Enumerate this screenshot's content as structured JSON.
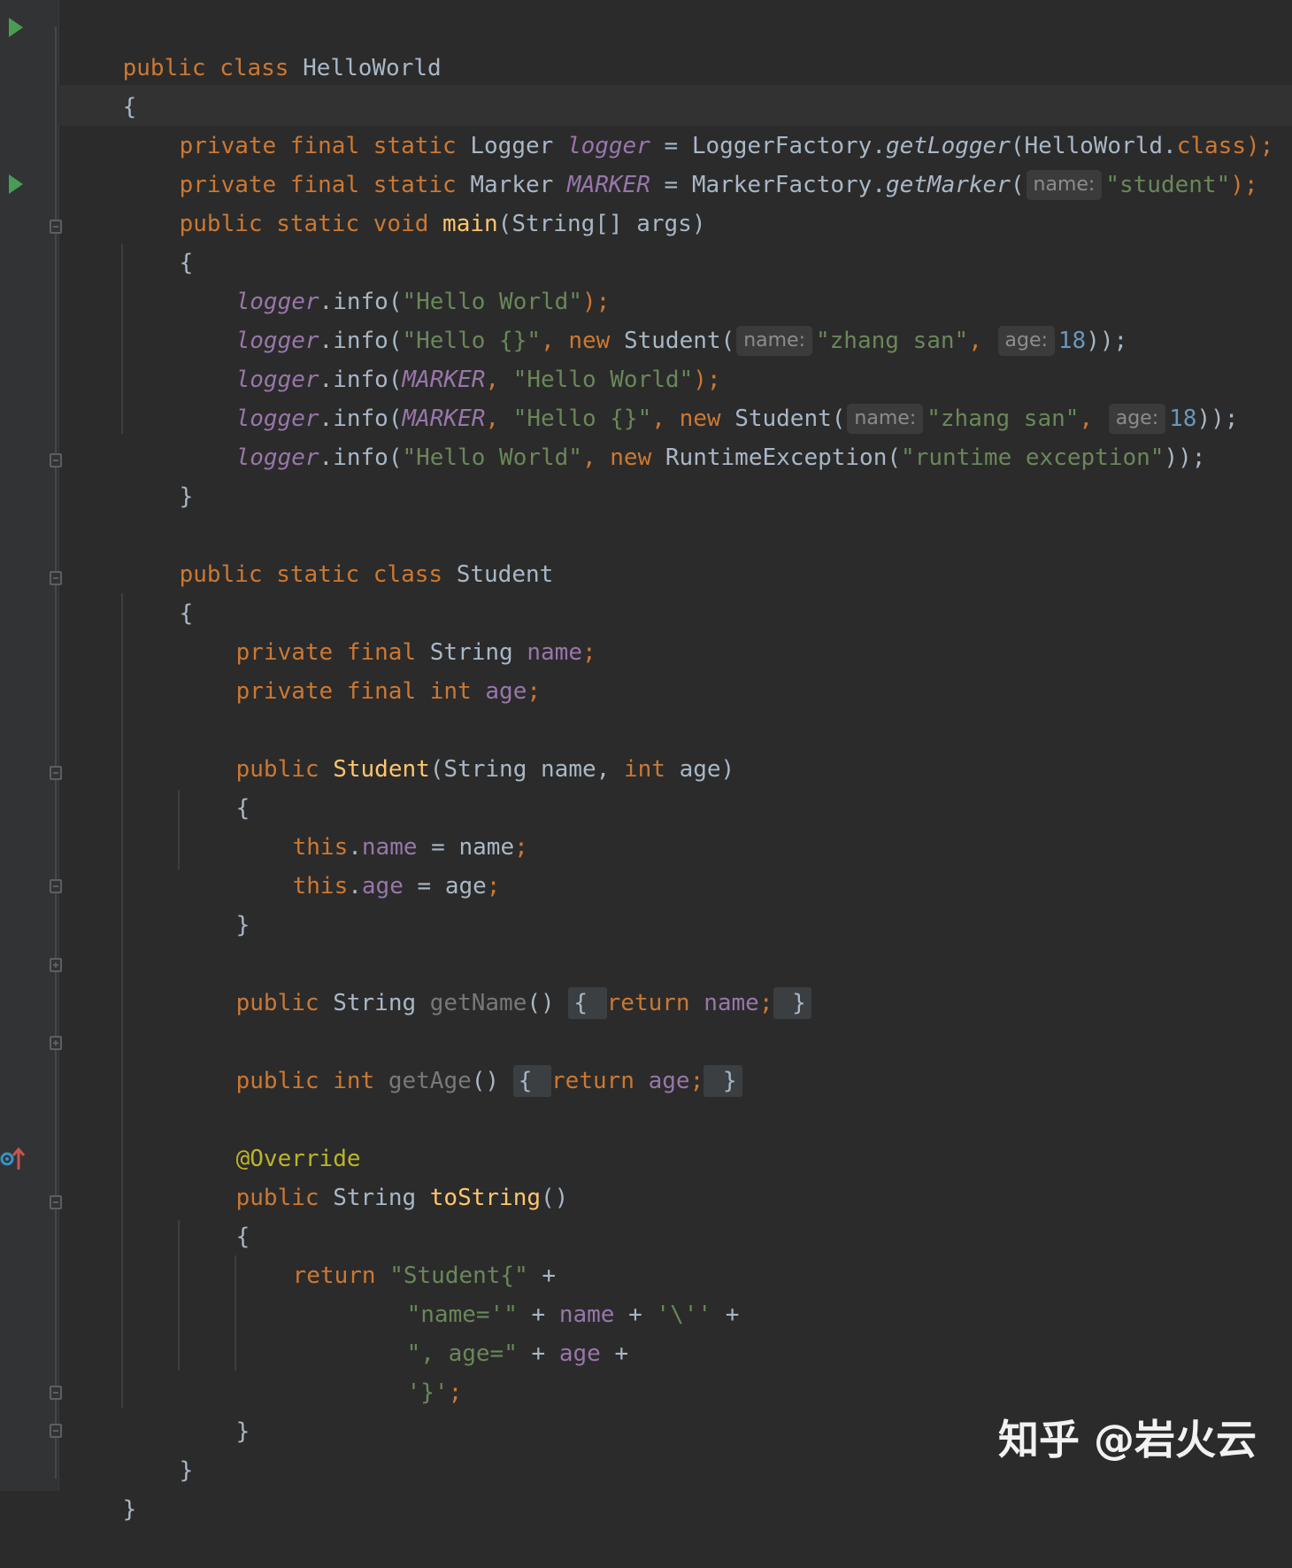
{
  "editor": {
    "language": "java",
    "theme": "darcula"
  },
  "code": {
    "l1": {
      "a": "public class ",
      "b": "HelloWorld"
    },
    "l2": {
      "a": "{"
    },
    "l3": {
      "a": "private final static ",
      "b": "Logger ",
      "c": "logger",
      "d": " = LoggerFactory.",
      "e": "getLogger",
      "f": "(HelloWorld.",
      "g": "class",
      "h": ");"
    },
    "l4": {
      "a": "private final static ",
      "b": "Marker ",
      "c": "MARKER",
      "d": " = MarkerFactory.",
      "e": "getMarker",
      "f": "(",
      "hint": "name:",
      "g": "\"student\"",
      "h": ");"
    },
    "l5": {
      "a": "public static void ",
      "b": "main",
      "c": "(String[] args)"
    },
    "l6": {
      "a": "{"
    },
    "l7": {
      "a": "logger",
      "b": ".info(",
      "c": "\"Hello World\"",
      "d": ");"
    },
    "l8": {
      "a": "logger",
      "b": ".info(",
      "c": "\"Hello {}\"",
      "d": ", ",
      "e": "new ",
      "f": "Student(",
      "hint1": "name:",
      "g": "\"zhang san\"",
      "h": ",",
      "hint2": "age:",
      "i": "18",
      "j": "));"
    },
    "l9": {
      "a": "logger",
      "b": ".info(",
      "c": "MARKER",
      "d": ", ",
      "e": "\"Hello World\"",
      "f": ");"
    },
    "l10": {
      "a": "logger",
      "b": ".info(",
      "c": "MARKER",
      "d": ", ",
      "e": "\"Hello {}\"",
      "f": ", ",
      "g": "new ",
      "h": "Student(",
      "hint1": "name:",
      "i": "\"zhang san\"",
      "j": ",",
      "hint2": "age:",
      "k": "18",
      "l": "));"
    },
    "l11": {
      "a": "logger",
      "b": ".info(",
      "c": "\"Hello World\"",
      "d": ", ",
      "e": "new ",
      "f": "RuntimeException(",
      "g": "\"runtime exception\"",
      "h": "));"
    },
    "l12": {
      "a": "}"
    },
    "l13": {
      "a": "public static class ",
      "b": "Student"
    },
    "l14": {
      "a": "{"
    },
    "l15": {
      "a": "private final ",
      "b": "String ",
      "c": "name",
      "d": ";"
    },
    "l16": {
      "a": "private final int ",
      "b": "age",
      "c": ";"
    },
    "l17": {
      "a": "public ",
      "b": "Student",
      "c": "(String name, ",
      "d": "int ",
      "e": "age)"
    },
    "l18": {
      "a": "{"
    },
    "l19": {
      "a": "this",
      "b": ".",
      "c": "name",
      "d": " = name",
      "e": ";"
    },
    "l20": {
      "a": "this",
      "b": ".",
      "c": "age",
      "d": " = age",
      "e": ";"
    },
    "l21": {
      "a": "}"
    },
    "l22": {
      "a": "public ",
      "b": "String ",
      "c": "getName",
      "d": "() ",
      "e": "{ ",
      "f": "return ",
      "g": "name",
      "h": ";",
      "i": " }"
    },
    "l23": {
      "a": "public ",
      "b": "int ",
      "c": "getAge",
      "d": "() ",
      "e": "{ ",
      "f": "return ",
      "g": "age",
      "h": ";",
      "i": " }"
    },
    "l24": {
      "a": "@Override"
    },
    "l25": {
      "a": "public ",
      "b": "String ",
      "c": "toString",
      "d": "()"
    },
    "l26": {
      "a": "{"
    },
    "l27": {
      "a": "return ",
      "b": "\"Student{\"",
      "c": " +"
    },
    "l28": {
      "a": "\"name='\"",
      "b": " + ",
      "c": "name",
      "d": " + ",
      "e": "'\\''",
      "f": " +"
    },
    "l29": {
      "a": "\", age=\"",
      "b": " + ",
      "c": "age",
      "d": " +"
    },
    "l30": {
      "a": "'}'",
      "b": ";"
    },
    "l31": {
      "a": "}"
    },
    "l32": {
      "a": "}"
    },
    "l33": {
      "a": "}"
    }
  },
  "icons": {
    "run_main_class": "run-icon",
    "run_main_method": "run-icon",
    "override": "override-method-icon",
    "fold": "fold-marker-icon"
  },
  "colors": {
    "background": "#2b2b2b",
    "keyword": "#cc7832",
    "string": "#6a8759",
    "field": "#9876aa",
    "method_decl": "#ffc66d",
    "number": "#6897bb",
    "annotation": "#bbb529",
    "text": "#a9b7c6"
  },
  "watermark": {
    "text": "知乎 @岩火云"
  }
}
